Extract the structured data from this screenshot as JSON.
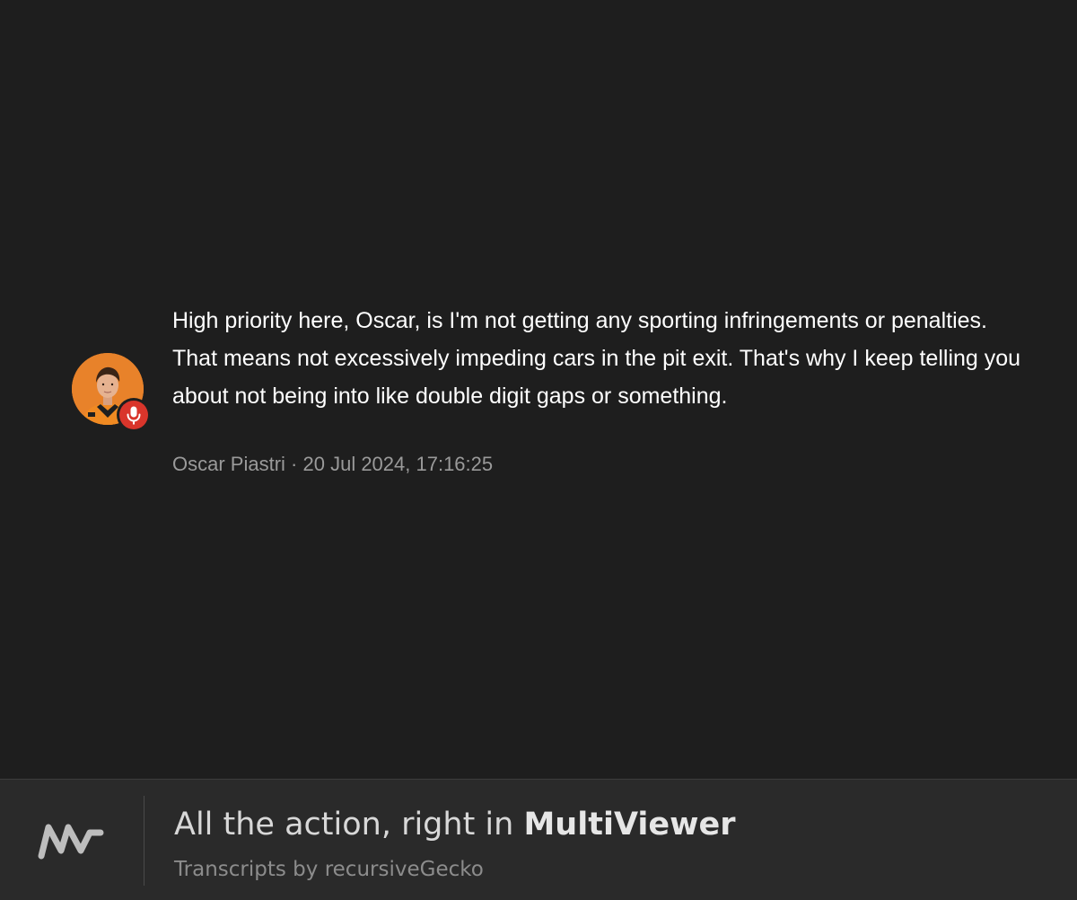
{
  "message": {
    "text": "High priority here, Oscar, is I'm not getting any sporting infringements or penalties. That means not excessively impeding cars in the pit exit. That's why I keep telling you about not being into like double digit gaps or something.",
    "author": "Oscar Piastri",
    "separator": "·",
    "timestamp": "20 Jul 2024, 17:16:25",
    "avatar_icon": "driver-portrait",
    "badge_icon": "microphone-icon",
    "colors": {
      "avatar_bg": "#e8822a",
      "badge_bg": "#d9352b"
    }
  },
  "footer": {
    "tagline_prefix": "All the action, right in ",
    "tagline_brand": "MultiViewer",
    "credit": "Transcripts by recursiveGecko",
    "logo_icon": "multiviewer-logo"
  },
  "colors": {
    "background": "#1e1e1e",
    "footer_bg": "#2a2a2a",
    "text": "#ffffff",
    "meta": "#9a9a9a"
  }
}
